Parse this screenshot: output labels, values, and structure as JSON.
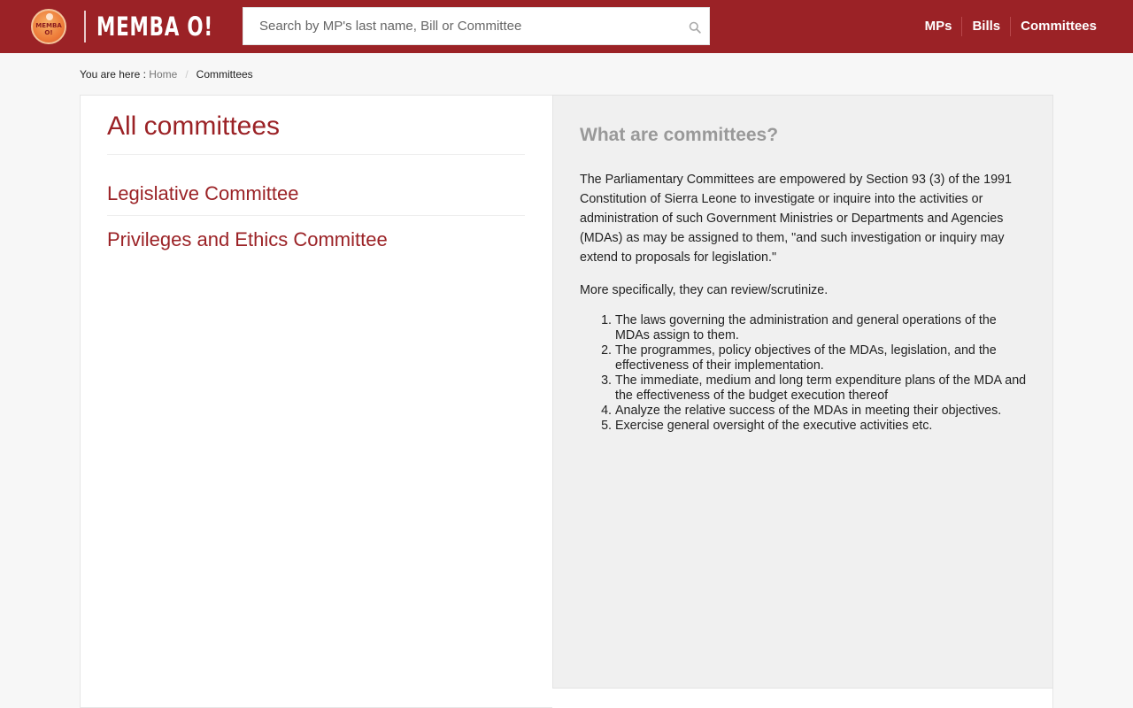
{
  "header": {
    "logo_badge_text": "MEMBA O!",
    "brand": "MEMBA O!",
    "search_placeholder": "Search by MP's last name, Bill or Committee",
    "nav": [
      {
        "label": "MPs"
      },
      {
        "label": "Bills"
      },
      {
        "label": "Committees"
      }
    ]
  },
  "breadcrumb": {
    "prefix": "You are here :",
    "home": "Home",
    "separator": "/",
    "current": "Committees"
  },
  "main": {
    "title": "All committees",
    "committees": [
      {
        "name": "Legislative Committee"
      },
      {
        "name": "Privileges and Ethics Committee"
      }
    ]
  },
  "sidebar": {
    "heading": "What are committees?",
    "paragraph1": "The Parliamentary Committees are empowered by Section 93 (3) of the 1991 Constitution of Sierra Leone to investigate or inquire into the activities or administration of such Government Ministries or Departments and Agencies (MDAs) as may be assigned to them, \"and such investigation or inquiry may extend to proposals for legislation.\"",
    "paragraph2": "More specifically, they can review/scrutinize.",
    "items": [
      "The laws governing the administration and general operations of the  MDAs assign to them.",
      "The programmes, policy objectives of the MDAs, legislation, and the effectiveness of their implementation.",
      "The immediate, medium and long term expenditure plans of the MDA and  the effectiveness of the budget execution thereof",
      "Analyze the relative success of the MDAs in meeting their objectives.",
      "Exercise general oversight of the executive activities etc."
    ]
  },
  "colors": {
    "brand_red": "#9b2226",
    "muted_heading": "#999999",
    "sidebar_bg": "#f0f0f0"
  },
  "icons": {
    "search": "search-icon",
    "logo": "memba-o-logo"
  }
}
